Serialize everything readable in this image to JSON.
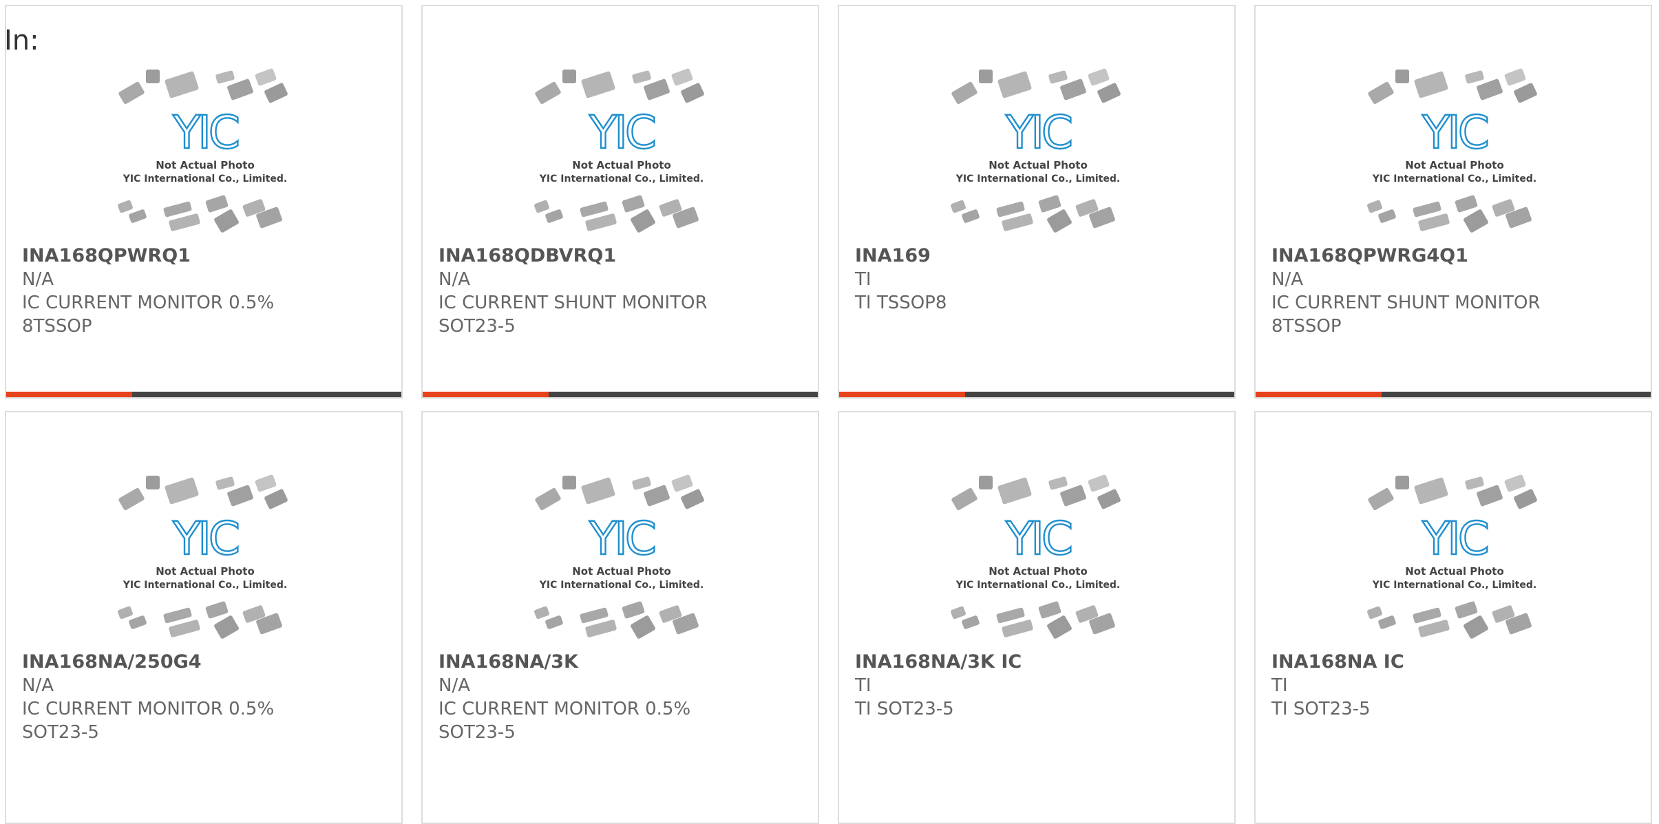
{
  "header": {
    "label": "In:"
  },
  "placeholder": {
    "line1": "Not Actual Photo",
    "line2": "YIC International Co., Limited.",
    "logo": "YIC"
  },
  "colors": {
    "accent": "#e8421c",
    "bar": "#444444",
    "border": "#dddddd",
    "logo_blue": "#1f8fcf"
  },
  "products": [
    {
      "part": "INA168QPWRQ1",
      "manufacturer": "N/A",
      "desc1": "IC CURRENT MONITOR 0.5%",
      "desc2": "8TSSOP"
    },
    {
      "part": "INA168QDBVRQ1",
      "manufacturer": "N/A",
      "desc1": "IC CURRENT SHUNT MONITOR",
      "desc2": "SOT23-5"
    },
    {
      "part": "INA169",
      "manufacturer": "TI",
      "desc1": "TI TSSOP8",
      "desc2": ""
    },
    {
      "part": "INA168QPWRG4Q1",
      "manufacturer": "N/A",
      "desc1": "IC CURRENT SHUNT MONITOR",
      "desc2": "8TSSOP"
    },
    {
      "part": "INA168NA/250G4",
      "manufacturer": "N/A",
      "desc1": "IC CURRENT MONITOR 0.5%",
      "desc2": "SOT23-5"
    },
    {
      "part": "INA168NA/3K",
      "manufacturer": "N/A",
      "desc1": "IC CURRENT MONITOR 0.5%",
      "desc2": "SOT23-5"
    },
    {
      "part": "INA168NA/3K IC",
      "manufacturer": "TI",
      "desc1": "TI SOT23-5",
      "desc2": ""
    },
    {
      "part": "INA168NA IC",
      "manufacturer": "TI",
      "desc1": "TI SOT23-5",
      "desc2": ""
    }
  ]
}
